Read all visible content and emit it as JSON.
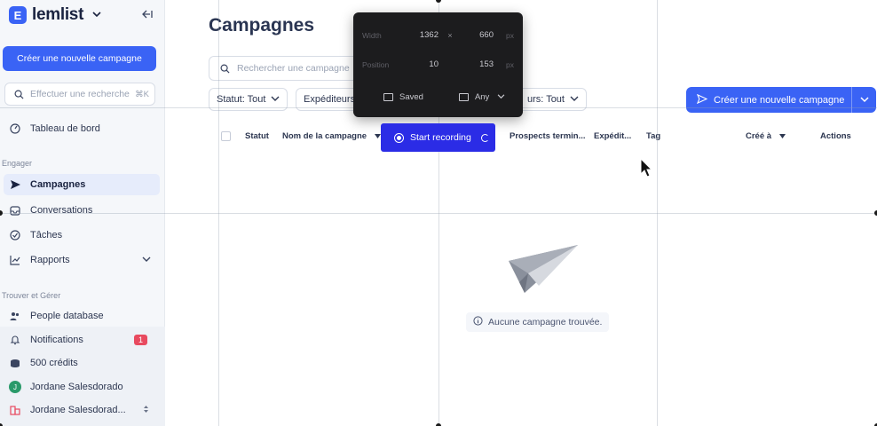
{
  "app": {
    "logo_letter": "E",
    "name": "lemlist"
  },
  "sidebar": {
    "new_campaign_label": "Créer une nouvelle campagne",
    "search_placeholder": "Effectuer une recherche",
    "search_shortcut": "⌘K",
    "dashboard_label": "Tableau de bord",
    "section_engage": "Engager",
    "items_engage": [
      {
        "label": "Campagnes",
        "icon": "send-icon"
      },
      {
        "label": "Conversations",
        "icon": "inbox-icon"
      },
      {
        "label": "Tâches",
        "icon": "check-circle-icon"
      },
      {
        "label": "Rapports",
        "icon": "chart-icon"
      }
    ],
    "section_find": "Trouver et Gérer",
    "people_db_label": "People database",
    "notifications_label": "Notifications",
    "notifications_count": "1",
    "credits_label": "500 crédits",
    "user_name": "Jordane Salesdorado",
    "user_initial": "J",
    "workspace_name": "Jordane Salesdorad..."
  },
  "main": {
    "title": "Campagnes",
    "search_placeholder": "Rechercher une campagne",
    "filters": [
      {
        "label": "Statut: Tout"
      },
      {
        "label": "Expéditeurs"
      },
      {
        "label": "urs: Tout"
      }
    ],
    "cta_label": "Créer une nouvelle campagne",
    "columns": [
      "Statut",
      "Nom de la campagne",
      "Prospects termin...",
      "Expédit...",
      "Tag",
      "Créé à",
      "Actions"
    ],
    "empty_message": "Aucune campagne trouvée."
  },
  "recorder": {
    "width_label": "Width",
    "width_value": "1362",
    "height_value": "660",
    "size_unit": "px",
    "position_label": "Position",
    "pos_x": "10",
    "pos_y": "153",
    "saved_label": "Saved",
    "any_label": "Any",
    "start_label": "Start recording"
  },
  "colors": {
    "accent": "#3a63f5",
    "record": "#2b2ce6",
    "badge": "#e84a5f"
  }
}
